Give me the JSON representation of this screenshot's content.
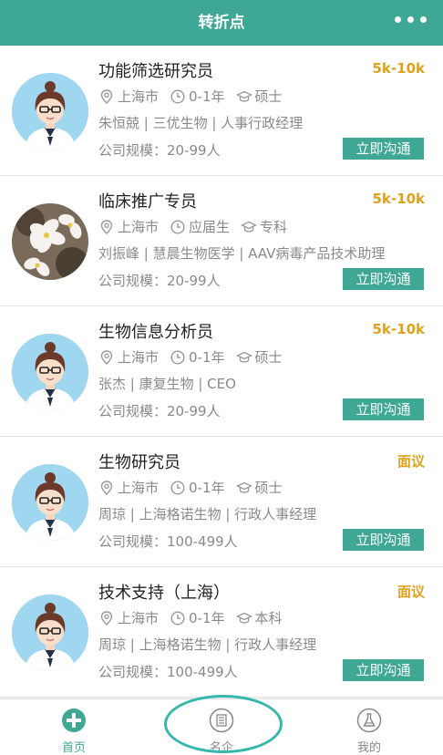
{
  "header": {
    "title": "转折点"
  },
  "colors": {
    "brand": "#3ea894",
    "salary": "#e0a21c",
    "ring": "#36b7ae"
  },
  "jobs": [
    {
      "title": "功能筛选研究员",
      "salary": "5k-10k",
      "location": "上海市",
      "experience": "0-1年",
      "education": "硕士",
      "company_line": "朱恒兢 | 三优生物 | 人事行政经理",
      "company_size": "公司规模：20-99人",
      "button": "立即沟通",
      "avatar": "avatar-cartoon"
    },
    {
      "title": "临床推广专员",
      "salary": "5k-10k",
      "location": "上海市",
      "experience": "应届生",
      "education": "专科",
      "company_line": "刘振峰 | 慧晨生物医学 | AAV病毒产品技术助理",
      "company_size": "公司规模：20-99人",
      "button": "立即沟通",
      "avatar": "avatar-flower-photo"
    },
    {
      "title": "生物信息分析员",
      "salary": "5k-10k",
      "location": "上海市",
      "experience": "0-1年",
      "education": "硕士",
      "company_line": "张杰 | 康复生物 | CEO",
      "company_size": "公司规模：20-99人",
      "button": "立即沟通",
      "avatar": "avatar-cartoon"
    },
    {
      "title": "生物研究员",
      "salary": "面议",
      "location": "上海市",
      "experience": "0-1年",
      "education": "硕士",
      "company_line": "周琼 | 上海格诺生物 | 行政人事经理",
      "company_size": "公司规模：100-499人",
      "button": "立即沟通",
      "avatar": "avatar-cartoon"
    },
    {
      "title": "技术支持（上海）",
      "salary": "面议",
      "location": "上海市",
      "experience": "0-1年",
      "education": "本科",
      "company_line": "周琼 | 上海格诺生物 | 行政人事经理",
      "company_size": "公司规模：100-499人",
      "button": "立即沟通",
      "avatar": "avatar-cartoon"
    }
  ],
  "tabbar": [
    {
      "label": "首页",
      "icon": "plus-circle-icon",
      "active": true
    },
    {
      "label": "名企",
      "icon": "building-icon",
      "active": false
    },
    {
      "label": "我的",
      "icon": "flask-icon",
      "active": false
    }
  ]
}
